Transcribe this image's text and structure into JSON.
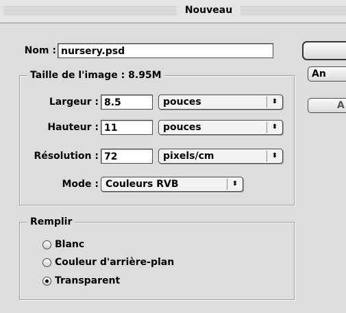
{
  "window": {
    "title": "Nouveau"
  },
  "name": {
    "label": "Nom :",
    "value": "nursery.psd"
  },
  "image_size": {
    "legend": "Taille de l'image : 8.95M",
    "width": {
      "label": "Largeur :",
      "value": "8.5",
      "unit": "pouces"
    },
    "height": {
      "label": "Hauteur :",
      "value": "11",
      "unit": "pouces"
    },
    "resolution": {
      "label": "Résolution :",
      "value": "72",
      "unit": "pixels/cm"
    },
    "mode": {
      "label": "Mode :",
      "value": "Couleurs RVB"
    }
  },
  "fill": {
    "legend": "Remplir",
    "options": [
      {
        "label": "Blanc",
        "selected": false
      },
      {
        "label": "Couleur d'arrière-plan",
        "selected": false
      },
      {
        "label": "Transparent",
        "selected": true
      }
    ]
  },
  "buttons": {
    "ok": "",
    "cancel": "An",
    "third": "A"
  }
}
